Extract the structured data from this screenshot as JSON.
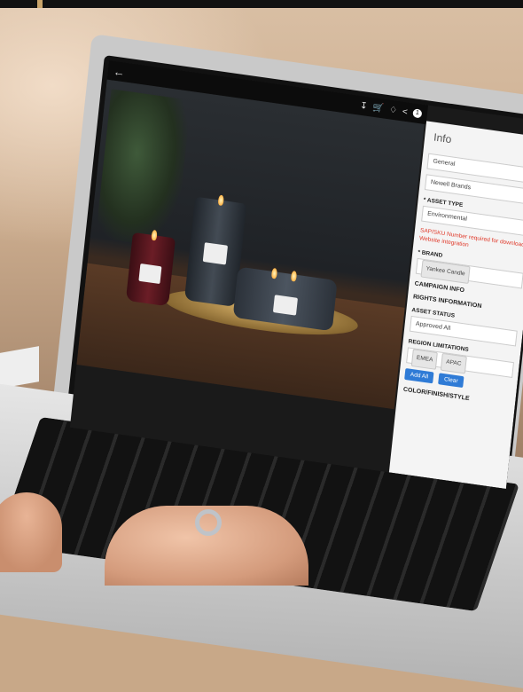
{
  "viewer": {
    "back_icon": "arrow-left-icon",
    "tools": [
      "download-icon",
      "cart-icon",
      "bell-icon",
      "share-icon"
    ],
    "badge_count": "1"
  },
  "info_panel": {
    "title": "Info",
    "general_select": "General",
    "brand_select": "Newell Brands",
    "asset_type_label": "* ASSET TYPE",
    "asset_type_value": "Environmental",
    "warning": "SAP/SKU Number required for download Website integration",
    "brand_label": "* BRAND",
    "brand_chip": "Yankee Candle",
    "campaign_section": "CAMPAIGN INFO",
    "rights_section": "RIGHTS INFORMATION",
    "asset_status_label": "ASSET STATUS",
    "asset_status_value": "Approved All",
    "region_label": "REGION LIMITATIONS",
    "region_chips": [
      "EMEA",
      "APAC"
    ],
    "add_all_button": "Add All",
    "clear_button": "Clear",
    "color_section": "COLOR/FINISH/STYLE"
  }
}
